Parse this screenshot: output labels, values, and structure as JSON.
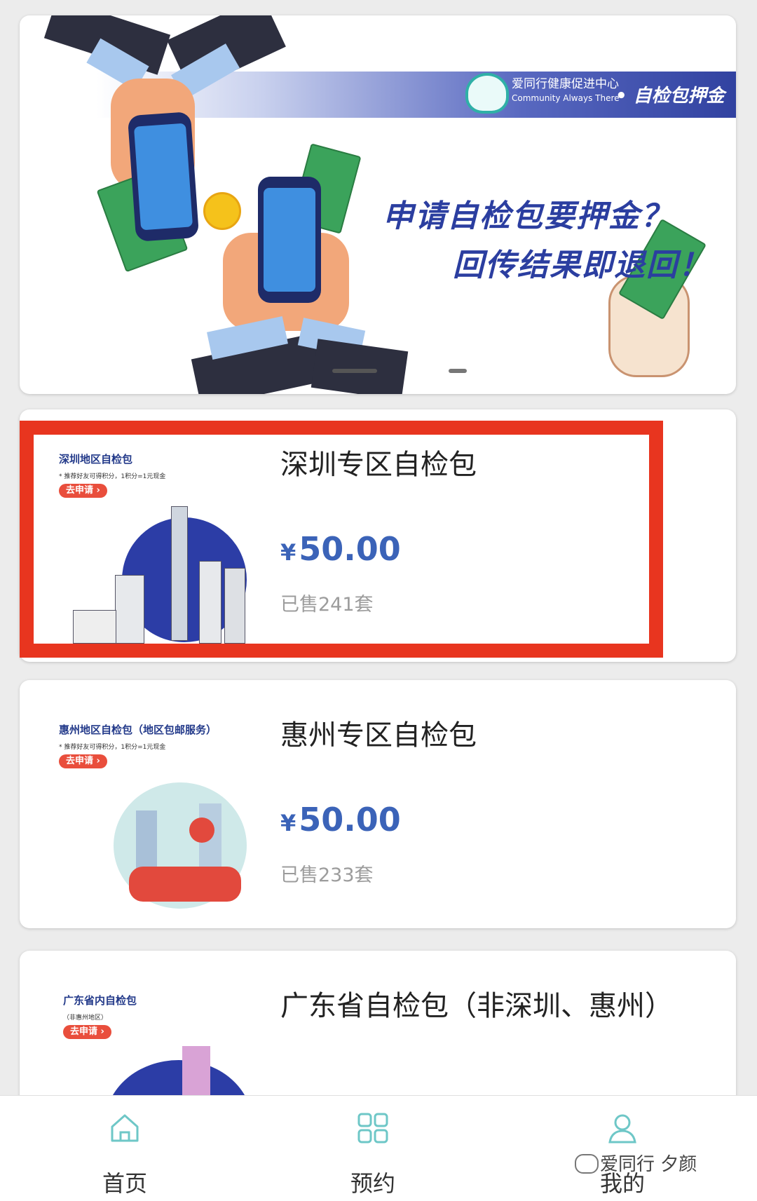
{
  "banner": {
    "org_name_cn": "爱同行健康促进中心",
    "org_name_en": "Community Always There",
    "tag": "• 自检包押金",
    "headline_1": "申请自检包要押金？",
    "headline_2": "回传结果即退回！",
    "carousel_dots": 2,
    "active_dot": 1
  },
  "products": [
    {
      "name": "深圳专区自检包",
      "price": "50.00",
      "currency": "¥",
      "sold": "已售241套",
      "image_title": "深圳地区自检包",
      "image_sub": "* 推荐好友可得积分，1积分=1元现金",
      "image_apply": "去申请 ›",
      "highlighted": true
    },
    {
      "name": "惠州专区自检包",
      "price": "50.00",
      "currency": "¥",
      "sold": "已售233套",
      "image_title": "惠州地区自检包（地区包邮服务）",
      "image_sub": "* 推荐好友可得积分，1积分=1元现金",
      "image_apply": "去申请 ›",
      "highlighted": false
    },
    {
      "name": "广东省自检包（非深圳、惠州）",
      "image_title": "广东省内自检包",
      "image_sub": "（非惠州地区）",
      "image_apply": "去申请 ›",
      "highlighted": false
    }
  ],
  "tabbar": {
    "items": [
      {
        "label": "首页",
        "icon": "home-icon"
      },
      {
        "label": "预约",
        "icon": "grid-icon"
      },
      {
        "label": "我的",
        "icon": "user-icon"
      }
    ]
  },
  "watermark": "爱同行 夕颜",
  "colors": {
    "accent_blue": "#3b63b8",
    "highlight_red": "#e8351f",
    "teal_icon": "#6ec7c7"
  }
}
